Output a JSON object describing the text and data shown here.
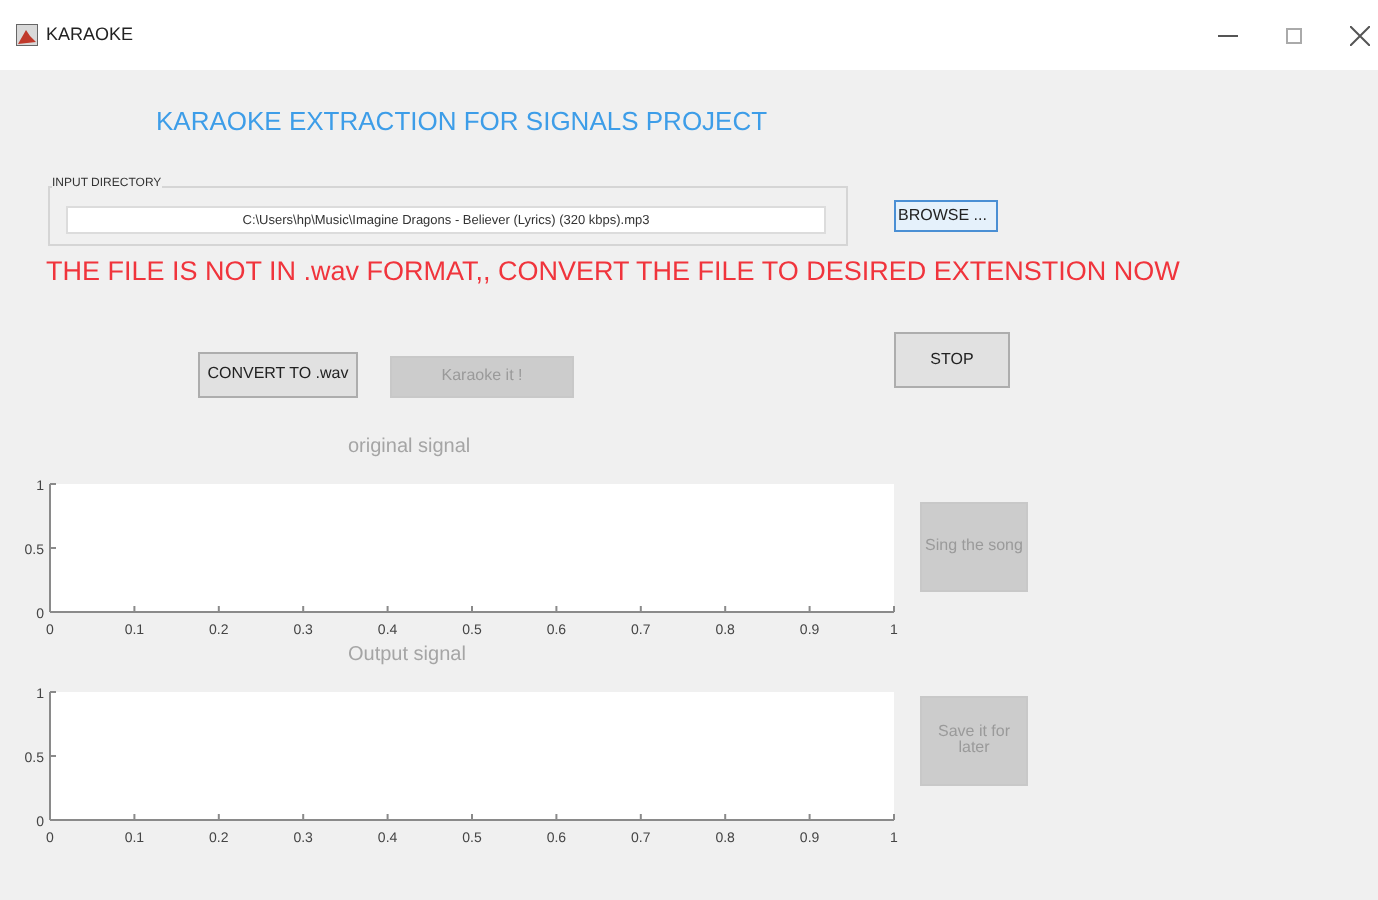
{
  "window": {
    "title": "KARAOKE"
  },
  "heading": "KARAOKE EXTRACTION FOR SIGNALS PROJECT",
  "input_directory": {
    "label": "INPUT DIRECTORY",
    "value": "C:\\Users\\hp\\Music\\Imagine Dragons - Believer (Lyrics) (320 kbps).mp3"
  },
  "browse_button": {
    "label": "BROWSE ...",
    "disabled": false
  },
  "message": "THE FILE IS NOT IN .wav FORMAT,, CONVERT THE FILE TO DESIRED EXTENSTION NOW",
  "stop_button": {
    "label": "STOP",
    "disabled": false
  },
  "convert_button": {
    "label": "CONVERT TO .wav",
    "disabled": false
  },
  "karaoke_button": {
    "label": "Karaoke it !",
    "disabled": true
  },
  "plots": [
    {
      "title": "original signal",
      "button": {
        "label": "Sing the song",
        "disabled": true
      },
      "chart_data": {
        "type": "line",
        "xlim": [
          0,
          1
        ],
        "ylim": [
          0,
          1
        ],
        "xticks": [
          0,
          0.1,
          0.2,
          0.3,
          0.4,
          0.5,
          0.6,
          0.7,
          0.8,
          0.9,
          1
        ],
        "yticks": [
          0,
          0.5,
          1
        ]
      }
    },
    {
      "title": "Output signal",
      "button": {
        "label": "Save it for later",
        "disabled": true
      },
      "chart_data": {
        "type": "line",
        "xlim": [
          0,
          1
        ],
        "ylim": [
          0,
          1
        ],
        "xticks": [
          0,
          0.1,
          0.2,
          0.3,
          0.4,
          0.5,
          0.6,
          0.7,
          0.8,
          0.9,
          1
        ],
        "yticks": [
          0,
          0.5,
          1
        ]
      }
    }
  ]
}
